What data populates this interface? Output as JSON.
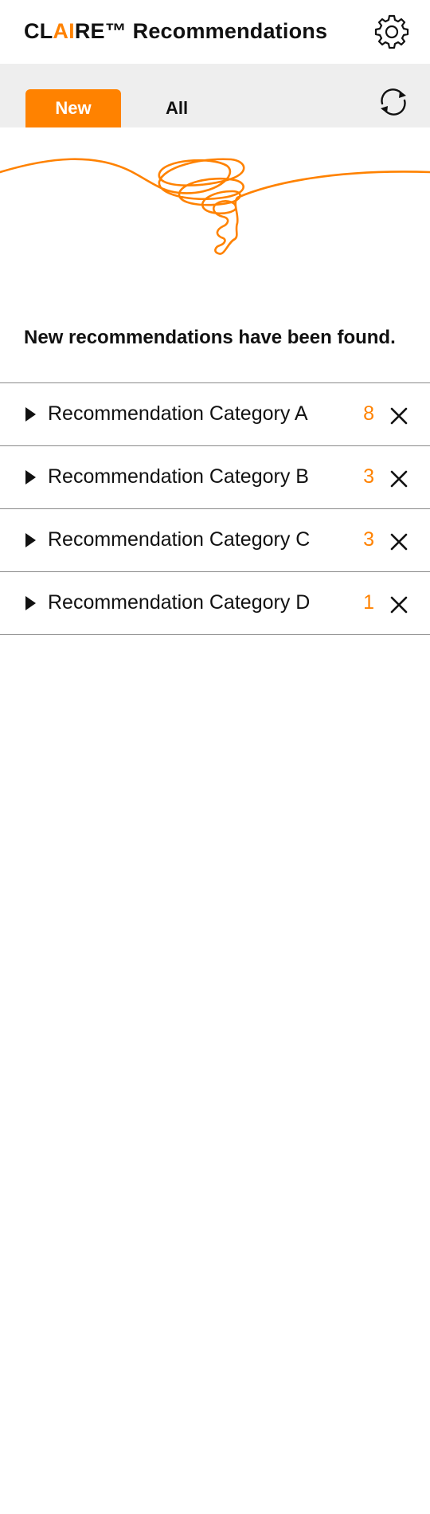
{
  "colors": {
    "accent": "#ff8200",
    "tabbar_bg": "#eeeeee",
    "divider": "#8a8a8a"
  },
  "header": {
    "title_prefix": "CL",
    "title_accent": "AI",
    "title_suffix": "RE™ Recommendations",
    "settings_icon": "gear-icon"
  },
  "tabs": {
    "new_label": "New",
    "all_label": "All",
    "refresh_icon": "refresh-icon"
  },
  "message": "New recommendations have been found.",
  "categories": [
    {
      "label": "Recommendation Category A",
      "count": "8"
    },
    {
      "label": "Recommendation Category B",
      "count": "3"
    },
    {
      "label": "Recommendation Category C",
      "count": "3"
    },
    {
      "label": "Recommendation Category D",
      "count": "1"
    }
  ]
}
